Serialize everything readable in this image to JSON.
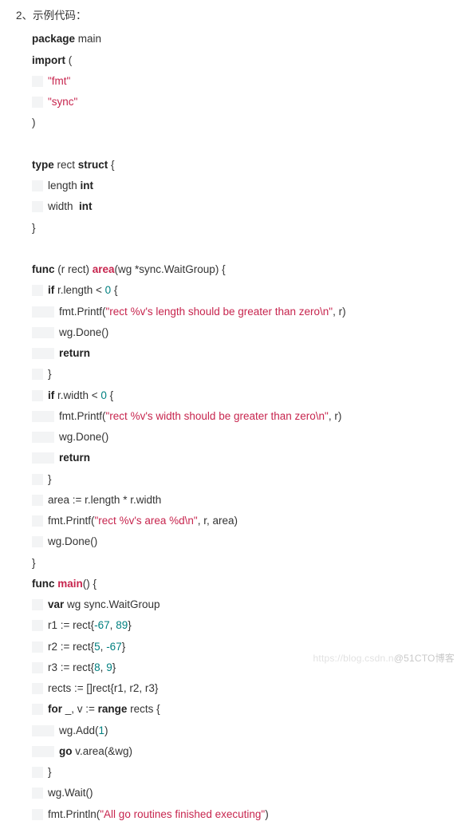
{
  "heading": "2、示例代码：",
  "code": {
    "l1": {
      "kw1": "package",
      "t": " main"
    },
    "l2": {
      "kw1": "import",
      "t": " ("
    },
    "l3": {
      "str": "\"fmt\""
    },
    "l4": {
      "str": "\"sync\""
    },
    "l5": {
      "t": ")"
    },
    "l6": {
      "kw1": "type",
      "t1": " rect ",
      "kw2": "struct",
      "t2": " {"
    },
    "l7": {
      "t1": "length ",
      "kw": "int"
    },
    "l8": {
      "t1": "width  ",
      "kw": "int"
    },
    "l9": {
      "t": "}"
    },
    "l10": {
      "kw1": "func",
      "t1": " (r rect) ",
      "fn": "area",
      "t2": "(wg *sync.WaitGroup) {"
    },
    "l11": {
      "kw": "if",
      "t1": " r.length < ",
      "num": "0",
      "t2": " {"
    },
    "l12": {
      "t1": "fmt.Printf(",
      "str": "\"rect %v's length should be greater than zero\\n\"",
      "t2": ", r)"
    },
    "l13": {
      "t": "wg.Done()"
    },
    "l14": {
      "kw": "return"
    },
    "l15": {
      "t": "}"
    },
    "l16": {
      "kw": "if",
      "t1": " r.width < ",
      "num": "0",
      "t2": " {"
    },
    "l17": {
      "t1": "fmt.Printf(",
      "str": "\"rect %v's width should be greater than zero\\n\"",
      "t2": ", r)"
    },
    "l18": {
      "t": "wg.Done()"
    },
    "l19": {
      "kw": "return"
    },
    "l20": {
      "t": "}"
    },
    "l21": {
      "t": "area := r.length * r.width"
    },
    "l22": {
      "t1": "fmt.Printf(",
      "str": "\"rect %v's area %d\\n\"",
      "t2": ", r, area)"
    },
    "l23": {
      "t": "wg.Done()"
    },
    "l24": {
      "t": "}"
    },
    "l25": {
      "kw1": "func",
      "t1": " ",
      "fn": "main",
      "t2": "() {"
    },
    "l26": {
      "kw": "var",
      "t": " wg sync.WaitGroup"
    },
    "l27": {
      "t1": "r1 := rect{",
      "num1": "-67",
      "t2": ", ",
      "num2": "89",
      "t3": "}"
    },
    "l28": {
      "t1": "r2 := rect{",
      "num1": "5",
      "t2": ", ",
      "num2": "-67",
      "t3": "}"
    },
    "l29": {
      "t1": "r3 := rect{",
      "num1": "8",
      "t2": ", ",
      "num2": "9",
      "t3": "}"
    },
    "l30": {
      "t": "rects := []rect{r1, r2, r3}"
    },
    "l31": {
      "kw1": "for",
      "t1": " _, v := ",
      "kw2": "range",
      "t2": " rects {"
    },
    "l32": {
      "t1": "wg.Add(",
      "num": "1",
      "t2": ")"
    },
    "l33": {
      "kw": "go",
      "t": " v.area(&wg)"
    },
    "l34": {
      "t": "}"
    },
    "l35": {
      "t": "wg.Wait()"
    },
    "l36": {
      "t1": "fmt.Println(",
      "str": "\"All go routines finished executing\"",
      "t2": ")"
    }
  },
  "watermark": {
    "left": "https://blog.csdn.n",
    "right": "@51CTO博客"
  }
}
